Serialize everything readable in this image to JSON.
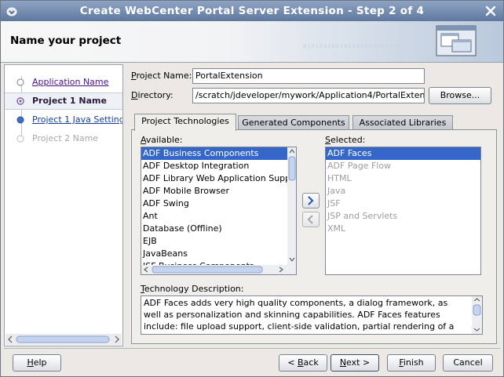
{
  "window": {
    "title": "Create WebCenter Portal Server Extension - Step 2 of 4",
    "colors": {
      "title_bar": "#6f86ab",
      "selection": "#3567c9",
      "link": "#4a0f86"
    }
  },
  "header": {
    "title": "Name your project",
    "binary_text": "010100100101010001000101"
  },
  "nav": {
    "steps": [
      {
        "label": "Application Name",
        "state": "visited"
      },
      {
        "label": "Project 1 Name",
        "state": "current"
      },
      {
        "label": "Project 1 Java Settings",
        "state": "visited"
      },
      {
        "label": "Project 2 Name",
        "state": "disabled"
      }
    ]
  },
  "form": {
    "project_name_label": "Project Name:",
    "project_name_value": "PortalExtension",
    "directory_label": "Directory:",
    "directory_value": "/scratch/jdeveloper/mywork/Application4/PortalExtension",
    "browse_label": "Browse..."
  },
  "tabs": [
    {
      "label": "Project Technologies",
      "active": true
    },
    {
      "label": "Generated Components",
      "active": false
    },
    {
      "label": "Associated Libraries",
      "active": false
    }
  ],
  "available": {
    "label": "Available:",
    "items": [
      "ADF Business Components",
      "ADF Desktop Integration",
      "ADF Library Web Application Support",
      "ADF Mobile Browser",
      "ADF Swing",
      "Ant",
      "Database (Offline)",
      "EJB",
      "JavaBeans",
      "JSF Business Components"
    ],
    "selected_index": 0
  },
  "selected": {
    "label": "Selected:",
    "items": [
      {
        "label": "ADF Faces",
        "enabled": true
      },
      {
        "label": "ADF Page Flow",
        "enabled": false
      },
      {
        "label": "HTML",
        "enabled": false
      },
      {
        "label": "Java",
        "enabled": false
      },
      {
        "label": "JSF",
        "enabled": false
      },
      {
        "label": "JSP and Servlets",
        "enabled": false
      },
      {
        "label": "XML",
        "enabled": false
      }
    ],
    "selected_index": 0
  },
  "description": {
    "label": "Technology Description:",
    "text": "ADF Faces adds very high quality components, a dialog framework, as well as personalization and skinning capabilities. ADF Faces features include: file upload support, client-side validation, partial rendering of a page"
  },
  "buttons": {
    "help": "Help",
    "back": "< Back",
    "next": "Next >",
    "finish": "Finish",
    "cancel": "Cancel"
  },
  "icons": {
    "system_menu": "window-menu-icon",
    "close": "close-icon",
    "add": "move-right-icon",
    "remove": "move-left-icon",
    "wizard": "wizard-graphic-icon"
  }
}
